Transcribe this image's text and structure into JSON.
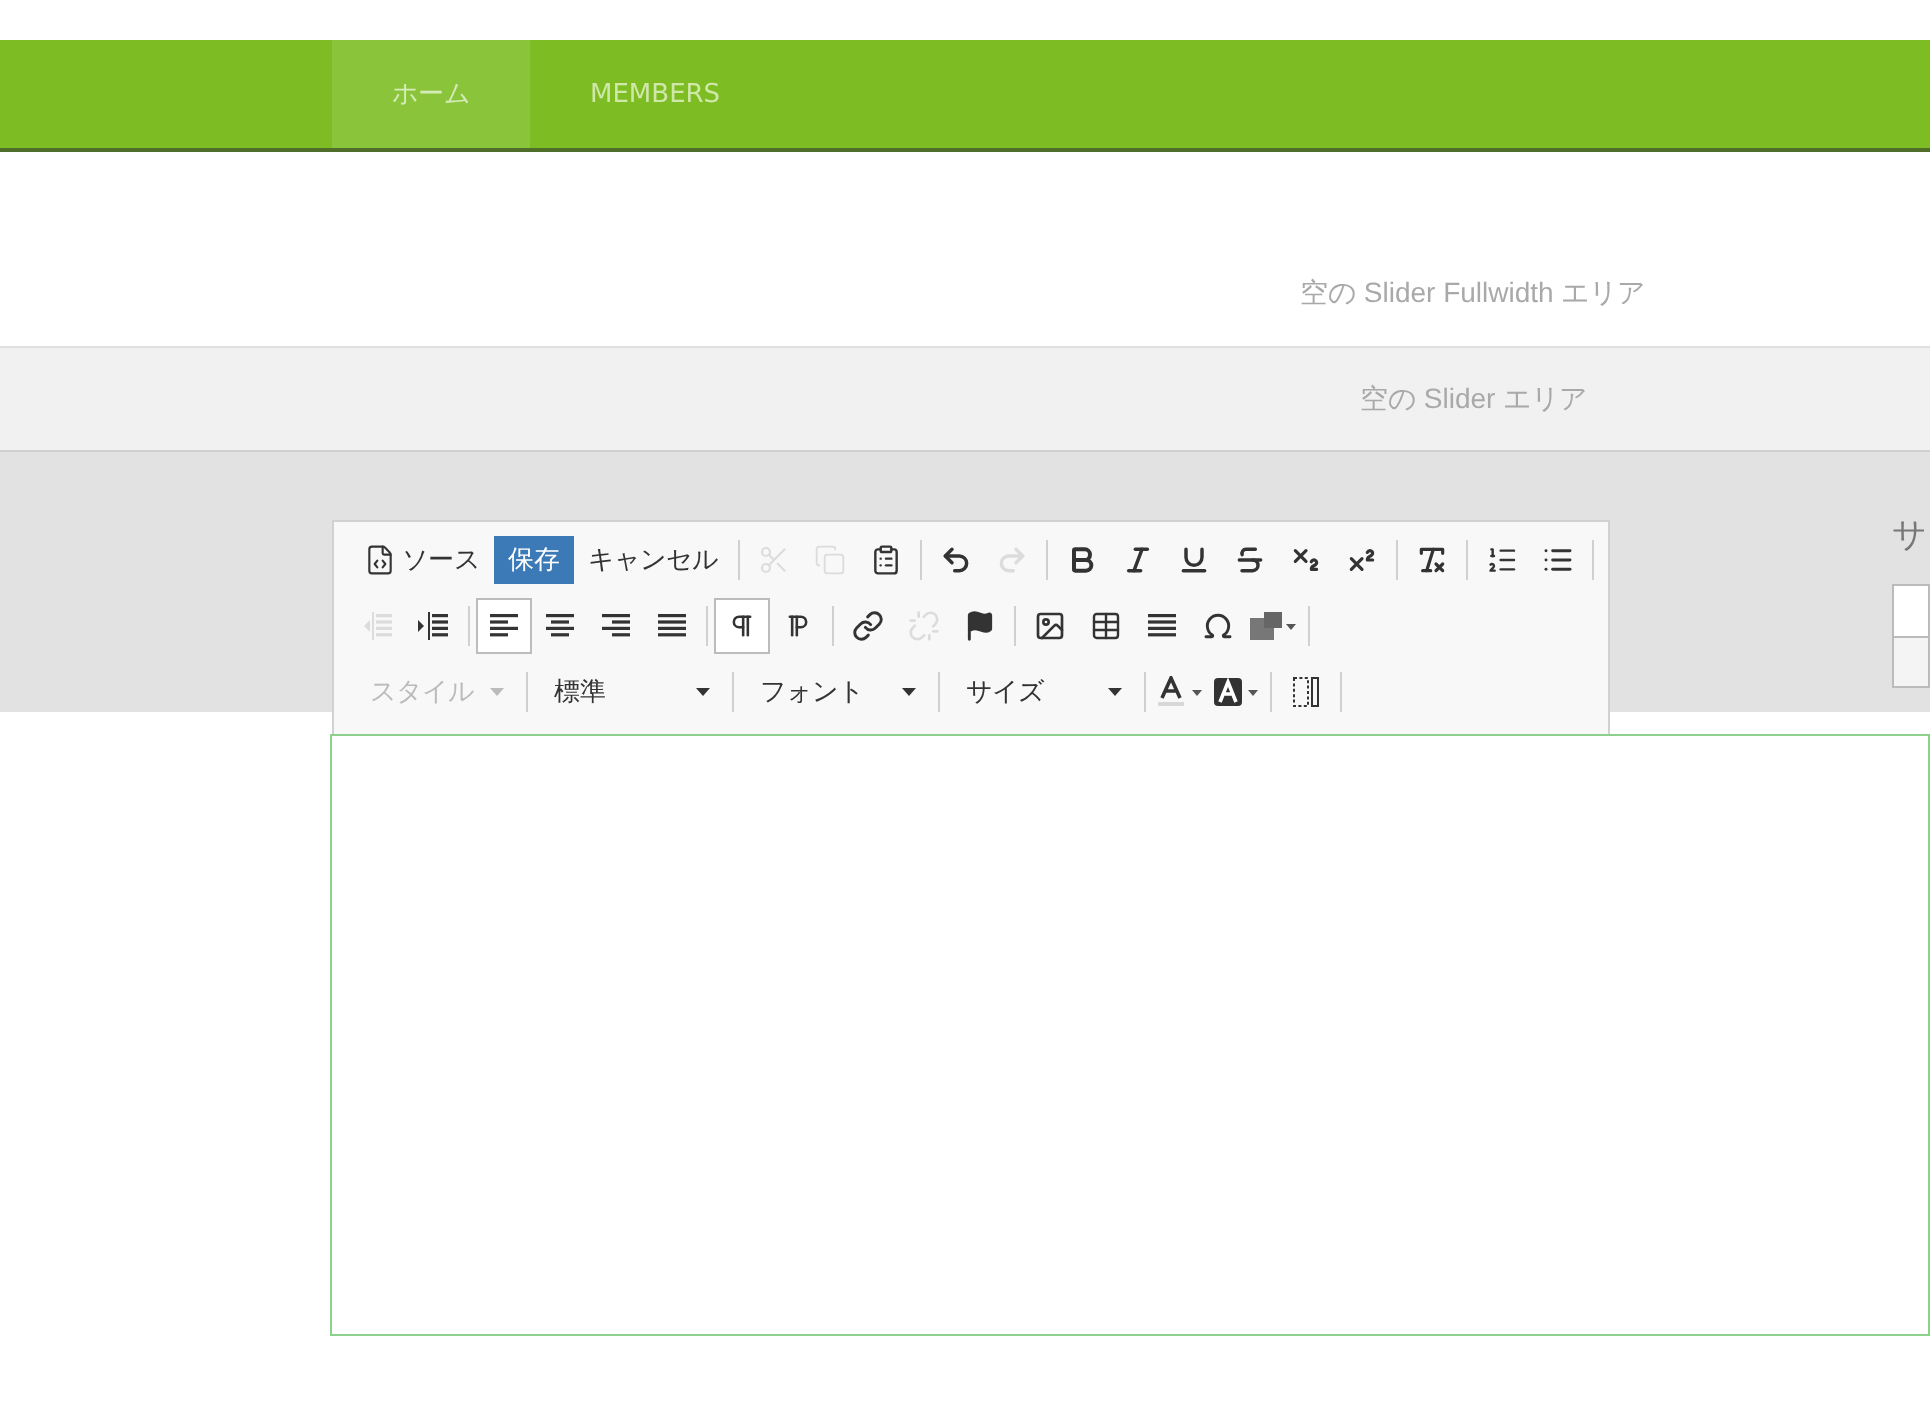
{
  "nav": {
    "items": [
      {
        "label": "ホーム",
        "selected": true
      },
      {
        "label": "MEMBERS",
        "selected": false
      }
    ]
  },
  "slider_fullwidth": {
    "text": "空の Slider Fullwidth エリア"
  },
  "slider": {
    "text": "空の Slider エリア"
  },
  "sidebar": {
    "title": "サ"
  },
  "toolbar": {
    "rows": [
      [
        [
          {
            "kind": "source",
            "label": "ソース",
            "on": false,
            "disabled": false
          },
          {
            "kind": "save",
            "label": "保存",
            "on": false,
            "disabled": false
          },
          {
            "kind": "cancel",
            "label": "キャンセル",
            "on": false,
            "disabled": false
          }
        ],
        [
          {
            "kind": "cut",
            "on": false,
            "disabled": true
          },
          {
            "kind": "copy",
            "on": false,
            "disabled": true
          },
          {
            "kind": "paste",
            "on": false,
            "disabled": false
          }
        ],
        [
          {
            "kind": "undo",
            "on": false,
            "disabled": false
          },
          {
            "kind": "redo",
            "on": false,
            "disabled": true
          }
        ],
        [
          {
            "kind": "bold",
            "on": false,
            "disabled": false
          },
          {
            "kind": "italic",
            "on": false,
            "disabled": false
          },
          {
            "kind": "underline",
            "on": false,
            "disabled": false
          },
          {
            "kind": "strike",
            "on": false,
            "disabled": false
          },
          {
            "kind": "subscript",
            "on": false,
            "disabled": false
          },
          {
            "kind": "superscript",
            "on": false,
            "disabled": false
          }
        ],
        [
          {
            "kind": "clear",
            "on": false,
            "disabled": false
          }
        ],
        [
          {
            "kind": "numbered",
            "on": false,
            "disabled": false
          },
          {
            "kind": "bulleted",
            "on": false,
            "disabled": false
          }
        ]
      ],
      [
        [
          {
            "kind": "outdent",
            "on": false,
            "disabled": true
          },
          {
            "kind": "indent",
            "on": false,
            "disabled": false
          }
        ],
        [
          {
            "kind": "left",
            "on": true,
            "disabled": false
          },
          {
            "kind": "center",
            "on": false,
            "disabled": false
          },
          {
            "kind": "right",
            "on": false,
            "disabled": false
          },
          {
            "kind": "justify",
            "on": false,
            "disabled": false
          }
        ],
        [
          {
            "kind": "ltr",
            "on": true,
            "disabled": false
          },
          {
            "kind": "rtl",
            "on": false,
            "disabled": false
          }
        ],
        [
          {
            "kind": "link",
            "on": false,
            "disabled": false
          },
          {
            "kind": "unlink",
            "on": false,
            "disabled": true
          },
          {
            "kind": "anchor",
            "on": false,
            "disabled": false
          }
        ],
        [
          {
            "kind": "image",
            "on": false,
            "disabled": false
          },
          {
            "kind": "table",
            "on": false,
            "disabled": false
          },
          {
            "kind": "rule",
            "on": false,
            "disabled": false
          },
          {
            "kind": "special",
            "on": false,
            "disabled": false
          },
          {
            "kind": "widget",
            "on": false,
            "disabled": false
          }
        ]
      ],
      [
        [
          {
            "kind": "combo",
            "label": "スタイル",
            "disabled": true
          }
        ],
        [
          {
            "kind": "combo",
            "label": "標準",
            "disabled": false
          }
        ],
        [
          {
            "kind": "combo",
            "label": "フォント",
            "disabled": false
          }
        ],
        [
          {
            "kind": "combo",
            "label": "サイズ",
            "disabled": false
          }
        ],
        [
          {
            "kind": "textcolor",
            "on": false,
            "disabled": false
          },
          {
            "kind": "bgcolor",
            "on": false,
            "disabled": false
          }
        ],
        [
          {
            "kind": "blocks",
            "on": false,
            "disabled": false
          }
        ]
      ]
    ]
  }
}
